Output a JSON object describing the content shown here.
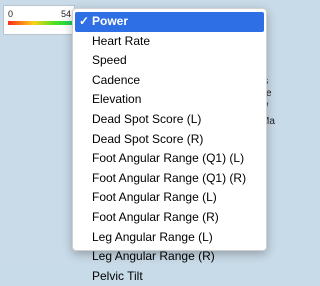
{
  "legend": {
    "min": "0",
    "max": "54"
  },
  "menu": {
    "selected_index": 0,
    "items": [
      {
        "label": "Power"
      },
      {
        "label": "Heart Rate"
      },
      {
        "label": "Speed"
      },
      {
        "label": "Cadence"
      },
      {
        "label": "Elevation"
      },
      {
        "label": "Dead Spot Score (L)"
      },
      {
        "label": "Dead Spot Score (R)"
      },
      {
        "label": "Foot Angular Range (Q1) (L)"
      },
      {
        "label": "Foot Angular Range (Q1) (R)"
      },
      {
        "label": "Foot Angular Range (L)"
      },
      {
        "label": "Foot Angular Range (R)"
      },
      {
        "label": "Leg Angular Range (L)"
      },
      {
        "label": "Leg Angular Range (R)"
      },
      {
        "label": "Pelvic Tilt"
      }
    ],
    "check_icon": "checkmark-icon",
    "selected_color": "#2f6fe6"
  },
  "side_text": [
    "ls",
    "ke",
    "w",
    "Ma"
  ]
}
